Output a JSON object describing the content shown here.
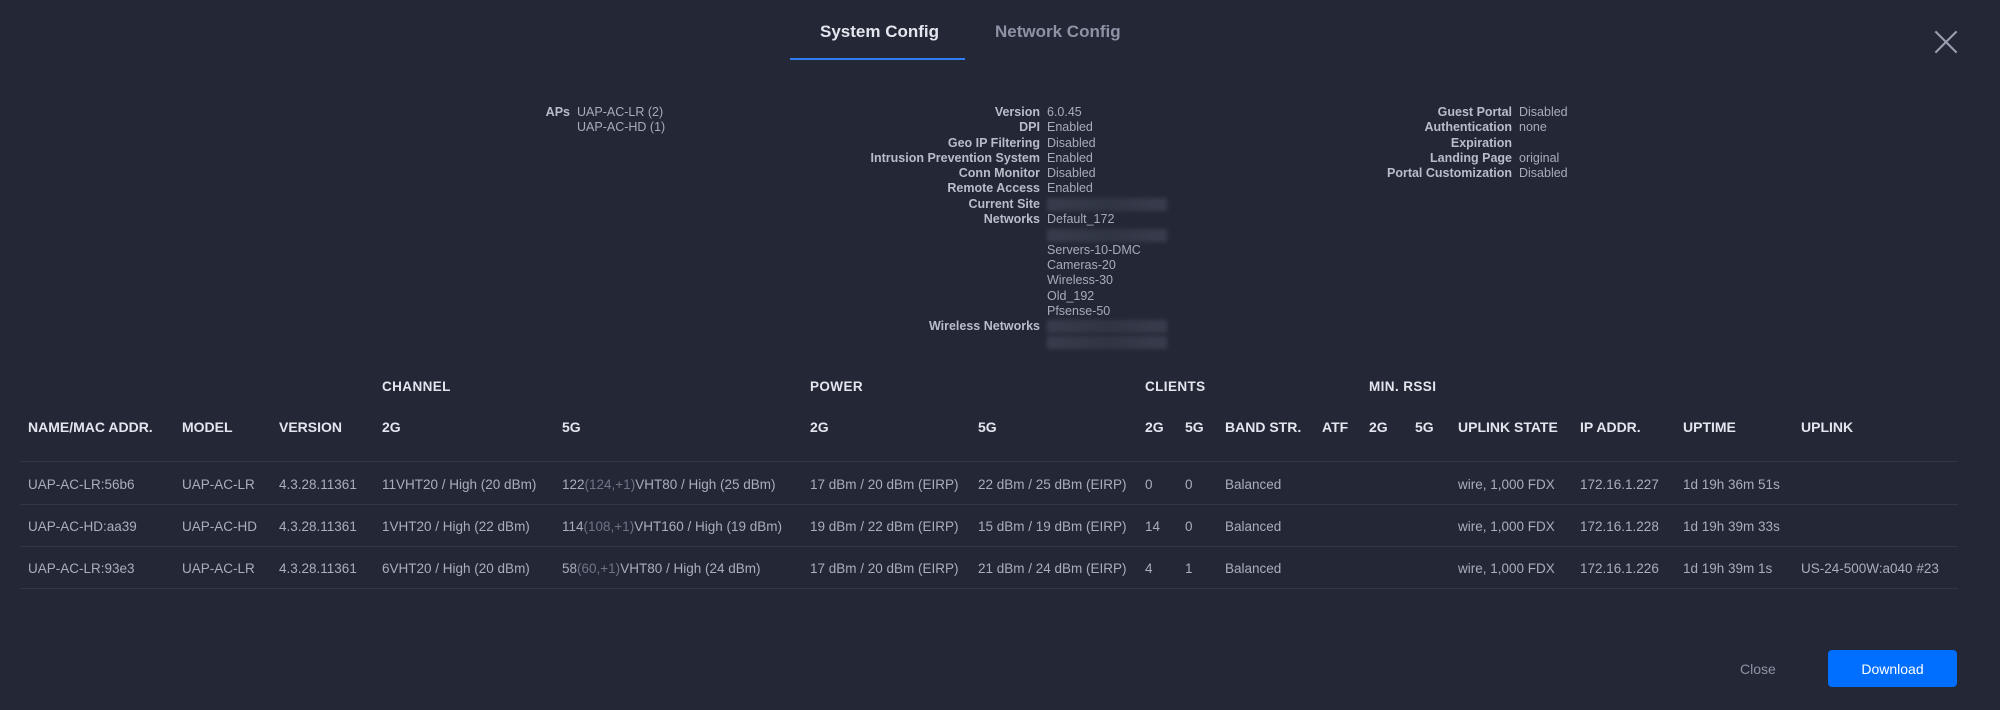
{
  "tabs": [
    {
      "label": "System Config",
      "active": true
    },
    {
      "label": "Network Config",
      "active": false
    }
  ],
  "summary": {
    "aps": {
      "label": "APs",
      "values": [
        "UAP-AC-LR (2)",
        "UAP-AC-HD (1)"
      ]
    },
    "system": [
      {
        "label": "Version",
        "values": [
          "6.0.45"
        ]
      },
      {
        "label": "DPI",
        "values": [
          "Enabled"
        ]
      },
      {
        "label": "Geo IP Filtering",
        "values": [
          "Disabled"
        ]
      },
      {
        "label": "Intrusion Prevention System",
        "values": [
          "Enabled"
        ]
      },
      {
        "label": "Conn Monitor",
        "values": [
          "Disabled"
        ]
      },
      {
        "label": "Remote Access",
        "values": [
          "Enabled"
        ]
      },
      {
        "label": "Current Site",
        "values": [
          ""
        ]
      },
      {
        "label": "Networks",
        "values": [
          "Default_172",
          "",
          "Servers-10-DMC",
          "Cameras-20",
          "Wireless-30",
          "Old_192",
          "Pfsense-50"
        ]
      },
      {
        "label": "Wireless Networks",
        "values": [
          "",
          ""
        ]
      }
    ],
    "guest": [
      {
        "label": "Guest Portal",
        "values": [
          "Disabled"
        ]
      },
      {
        "label": "Authentication",
        "values": [
          "none"
        ]
      },
      {
        "label": "Expiration",
        "values": [
          ""
        ]
      },
      {
        "label": "Landing Page",
        "values": [
          "original"
        ]
      },
      {
        "label": "Portal Customization",
        "values": [
          "Disabled"
        ]
      }
    ]
  },
  "table": {
    "groups": {
      "channel": "CHANNEL",
      "power": "POWER",
      "clients": "CLIENTS",
      "min_rssi": "MIN. RSSI"
    },
    "headers": {
      "name": "NAME/MAC ADDR.",
      "model": "MODEL",
      "version": "VERSION",
      "ch2g": "2G",
      "ch5g": "5G",
      "pw2g": "2G",
      "pw5g": "5G",
      "cl2g": "2G",
      "cl5g": "5G",
      "band": "BAND STR.",
      "atf": "ATF",
      "rs2g": "2G",
      "rs5g": "5G",
      "uplink_state": "UPLINK STATE",
      "ip": "IP ADDR.",
      "uptime": "UPTIME",
      "uplink": "UPLINK"
    },
    "rows": [
      {
        "name": "UAP-AC-LR:56b6",
        "model": "UAP-AC-LR",
        "version": "4.3.28.11361",
        "ch2g": "11VHT20 / High (20 dBm)",
        "ch5g_a": "122",
        "ch5g_b": "(124,+1)",
        "ch5g_c": "VHT80 / High (25 dBm)",
        "pw2g": "17 dBm / 20 dBm (EIRP)",
        "pw5g": "22 dBm / 25 dBm (EIRP)",
        "cl2g": "0",
        "cl5g": "0",
        "band": "Balanced",
        "atf": "",
        "rs2g": "",
        "rs5g": "",
        "uplink_state": "wire, 1,000 FDX",
        "ip": "172.16.1.227",
        "uptime": "1d 19h 36m 51s",
        "uplink": ""
      },
      {
        "name": "UAP-AC-HD:aa39",
        "model": "UAP-AC-HD",
        "version": "4.3.28.11361",
        "ch2g": "1VHT20 / High (22 dBm)",
        "ch5g_a": "114",
        "ch5g_b": "(108,+1)",
        "ch5g_c": "VHT160 / High (19 dBm)",
        "pw2g": "19 dBm / 22 dBm (EIRP)",
        "pw5g": "15 dBm / 19 dBm (EIRP)",
        "cl2g": "14",
        "cl5g": "0",
        "band": "Balanced",
        "atf": "",
        "rs2g": "",
        "rs5g": "",
        "uplink_state": "wire, 1,000 FDX",
        "ip": "172.16.1.228",
        "uptime": "1d 19h 39m 33s",
        "uplink": ""
      },
      {
        "name": "UAP-AC-LR:93e3",
        "model": "UAP-AC-LR",
        "version": "4.3.28.11361",
        "ch2g": "6VHT20 / High (20 dBm)",
        "ch5g_a": "58",
        "ch5g_b": "(60,+1)",
        "ch5g_c": "VHT80 / High (24 dBm)",
        "pw2g": "17 dBm / 20 dBm (EIRP)",
        "pw5g": "21 dBm / 24 dBm (EIRP)",
        "cl2g": "4",
        "cl5g": "1",
        "band": "Balanced",
        "atf": "",
        "rs2g": "",
        "rs5g": "",
        "uplink_state": "wire, 1,000 FDX",
        "ip": "172.16.1.226",
        "uptime": "1d 19h 39m 1s",
        "uplink": "US-24-500W:a040 #23"
      }
    ]
  },
  "footer": {
    "close_label": "Close",
    "download_label": "Download"
  }
}
